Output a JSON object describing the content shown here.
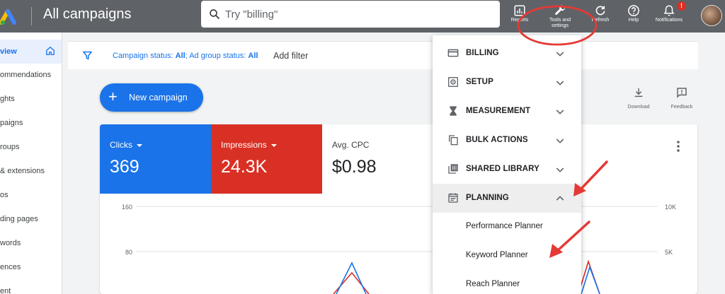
{
  "header": {
    "title": "All campaigns",
    "search_placeholder": "Try \"billing\"",
    "actions": [
      {
        "label": "Reports",
        "icon": "reports-icon"
      },
      {
        "label": "Tools and settings",
        "icon": "wrench-icon"
      },
      {
        "label": "Refresh",
        "icon": "refresh-icon"
      },
      {
        "label": "Help",
        "icon": "help-icon"
      },
      {
        "label": "Notifications",
        "icon": "bell-icon",
        "badge": "!"
      }
    ]
  },
  "sidebar": {
    "items": [
      {
        "label": "Overview",
        "visible_text": "view",
        "active": true
      },
      {
        "label": "Recommendations",
        "visible_text": "ommendations"
      },
      {
        "label": "Insights",
        "visible_text": "ghts"
      },
      {
        "label": "Campaigns",
        "visible_text": "paigns"
      },
      {
        "label": "Ad groups",
        "visible_text": "roups"
      },
      {
        "label": "Ads & extensions",
        "visible_text": "& extensions"
      },
      {
        "label": "Videos",
        "visible_text": "os"
      },
      {
        "label": "Landing pages",
        "visible_text": "ding pages"
      },
      {
        "label": "Keywords",
        "visible_text": "words"
      },
      {
        "label": "Audiences",
        "visible_text": "ences"
      },
      {
        "label": "Content",
        "visible_text": "ent"
      }
    ]
  },
  "filterbar": {
    "status_prefix": "Campaign status: ",
    "status_value": "All",
    "sep": "; Ad group status: ",
    "group_value": "All",
    "add_filter": "Add filter"
  },
  "new_campaign": {
    "label": "New campaign"
  },
  "toolbar_actions": {
    "download": "Download",
    "feedback": "Feedback"
  },
  "metrics": [
    {
      "label": "Clicks",
      "value": "369",
      "color": "#1a73e8"
    },
    {
      "label": "Impressions",
      "value": "24.3K",
      "color": "#d93025"
    },
    {
      "label": "Avg. CPC",
      "value": "$0.98"
    }
  ],
  "chart_data": {
    "type": "line",
    "left_axis": {
      "ticks": [
        "160",
        "80"
      ]
    },
    "right_axis": {
      "ticks": [
        "10K",
        "5K"
      ]
    },
    "series": [
      {
        "color": "#1a73e8"
      },
      {
        "color": "#d93025"
      }
    ]
  },
  "menu": {
    "sections": [
      {
        "label": "BILLING",
        "icon": "credit-card-icon",
        "open": false
      },
      {
        "label": "SETUP",
        "icon": "setup-gear-icon",
        "open": false
      },
      {
        "label": "MEASUREMENT",
        "icon": "hourglass-icon",
        "open": false
      },
      {
        "label": "BULK ACTIONS",
        "icon": "copy-icon",
        "open": false
      },
      {
        "label": "SHARED LIBRARY",
        "icon": "library-icon",
        "open": false
      },
      {
        "label": "PLANNING",
        "icon": "calendar-icon",
        "open": true
      }
    ],
    "planning_items": [
      "Performance Planner",
      "Keyword Planner",
      "Reach Planner"
    ]
  },
  "colors": {
    "topbar": "#5f6368",
    "primary": "#1a73e8",
    "accent_red": "#d93025",
    "annotation_red": "#e53935"
  }
}
